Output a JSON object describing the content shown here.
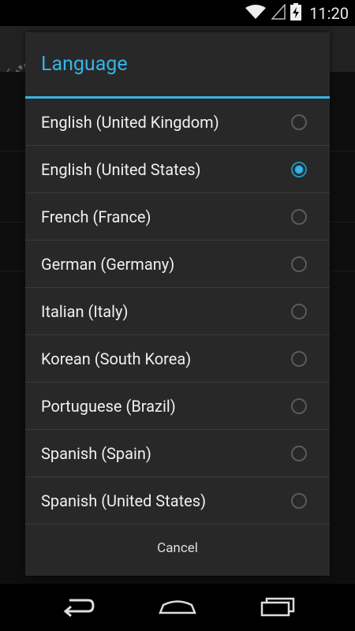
{
  "status_bar": {
    "time": "11:20"
  },
  "dialog": {
    "title": "Language",
    "options": [
      {
        "label": "English (United Kingdom)",
        "selected": false
      },
      {
        "label": "English (United States)",
        "selected": true
      },
      {
        "label": "French (France)",
        "selected": false
      },
      {
        "label": "German (Germany)",
        "selected": false
      },
      {
        "label": "Italian (Italy)",
        "selected": false
      },
      {
        "label": "Korean (South Korea)",
        "selected": false
      },
      {
        "label": "Portuguese (Brazil)",
        "selected": false
      },
      {
        "label": "Spanish (Spain)",
        "selected": false
      },
      {
        "label": "Spanish (United States)",
        "selected": false
      }
    ],
    "cancel_label": "Cancel"
  },
  "colors": {
    "accent": "#33b5e5",
    "dialog_bg": "#282828",
    "divider": "#3a3a3a"
  },
  "nav_bar": {
    "buttons": [
      "back-icon",
      "home-icon",
      "recent-apps-icon"
    ]
  }
}
